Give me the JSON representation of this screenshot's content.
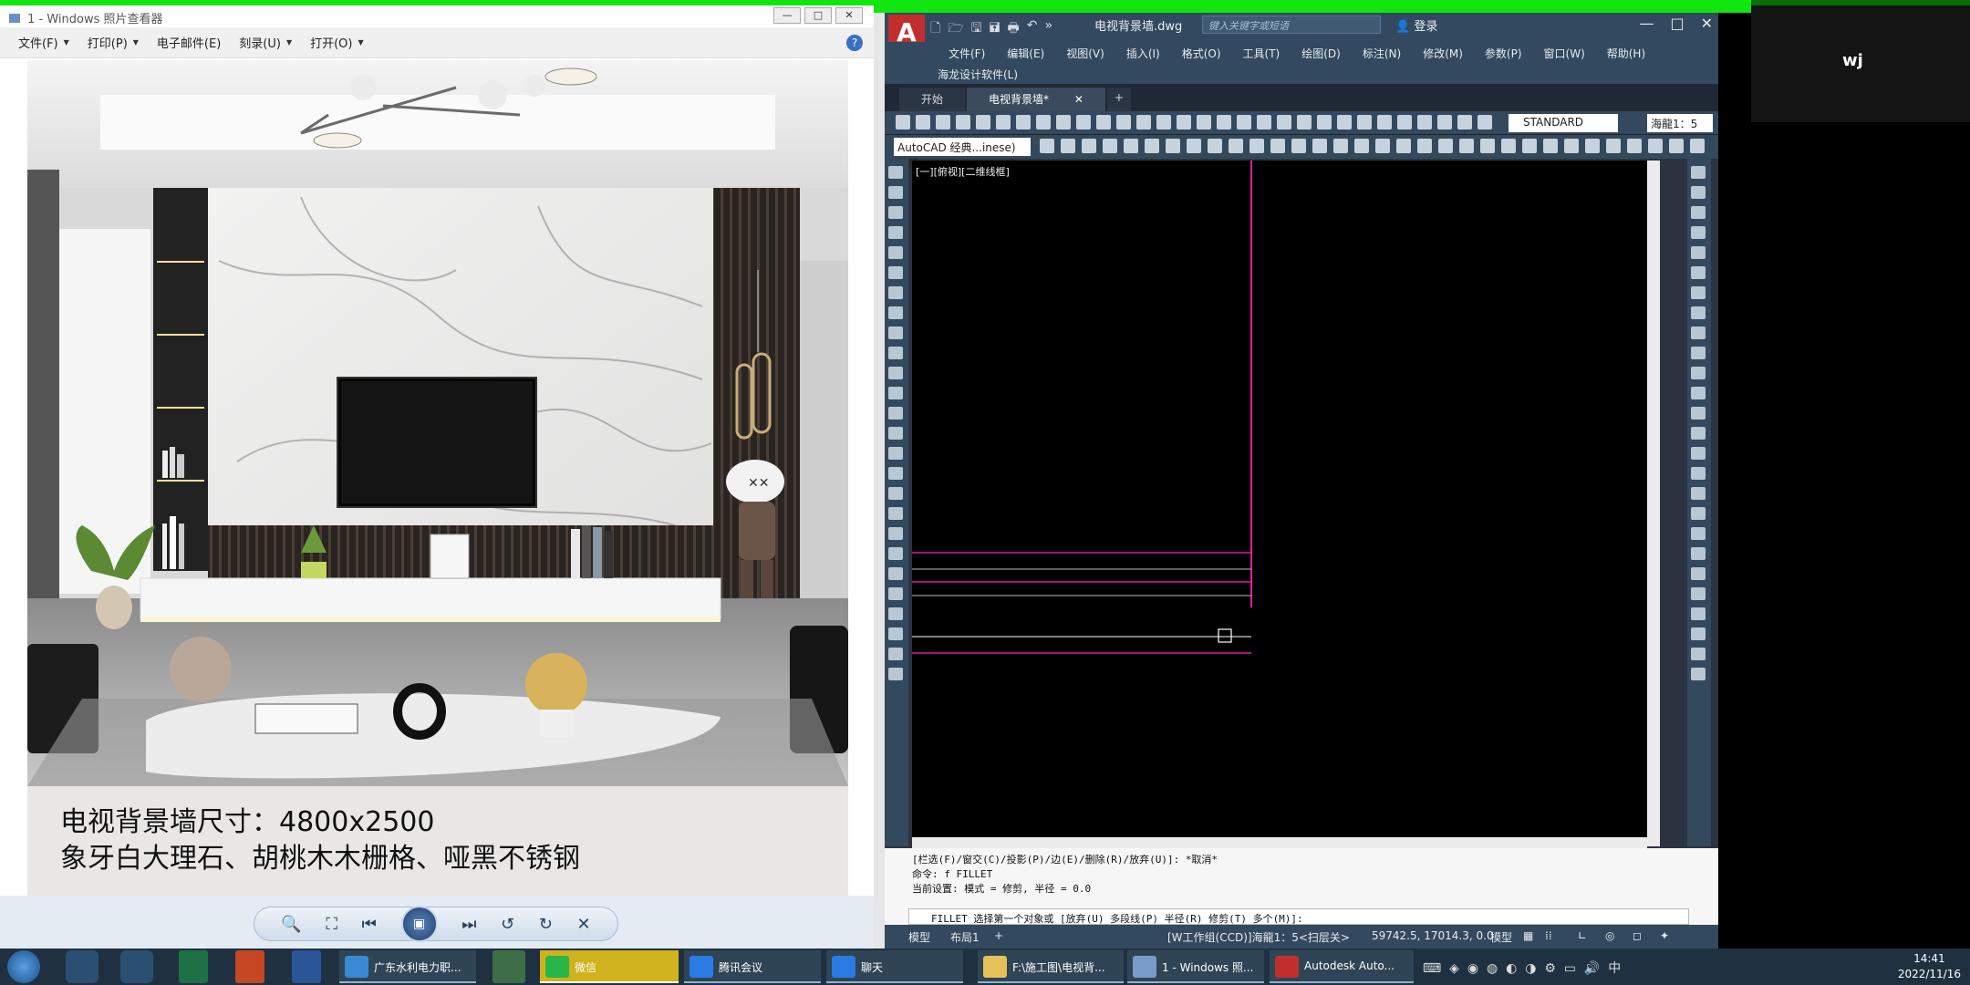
{
  "photo_viewer": {
    "title": "1 - Windows 照片查看器",
    "menu": [
      "文件(F)",
      "打印(P)",
      "电子邮件(E)",
      "刻录(U)",
      "打开(O)"
    ],
    "caption_line1": "电视背景墙尺寸：4800x2500",
    "caption_line2": "象牙白大理石、胡桃木木栅格、哑黑不锈钢"
  },
  "cad": {
    "filename": "电视背景墙.dwg",
    "search_placeholder": "键入关键字或短语",
    "login": "登录",
    "menu": [
      "文件(F)",
      "编辑(E)",
      "视图(V)",
      "插入(I)",
      "格式(O)",
      "工具(T)",
      "绘图(D)",
      "标注(N)",
      "修改(M)",
      "参数(P)",
      "窗口(W)",
      "帮助(H)"
    ],
    "menu_extra": "海龙设计软件(L)",
    "tabs": [
      "开始",
      "电视背景墙*"
    ],
    "workspace": "AutoCAD 经典...inese) 移植",
    "text_style": "STANDARD",
    "scale": "海龍1：5",
    "viewport_label": "[一][俯视][二维线框]",
    "command_lines": [
      "[栏选(F)/窗交(C)/投影(P)/边(E)/删除(R)/放弃(U)]:  *取消*",
      "命令: f FILLET",
      "当前设置: 模式 = 修剪, 半径 = 0.0"
    ],
    "command_prompt": "FILLET 选择第一个对象或 [放弃(U) 多段线(P) 半径(R) 修剪(T) 多个(M)]:",
    "layout_tabs": [
      "模型",
      "布局1"
    ],
    "status_workgroup": "[W工作组(CCD)]海龍1：5<扫层关>",
    "status_coords": "59742.5, 17014.3, 0.0",
    "status_model": "模型"
  },
  "right_panel": {
    "user": "wj"
  },
  "taskbar": {
    "windows": [
      "广东水利电力职...",
      "腾讯会议",
      "聊天",
      "F:\\施工图\\电视背...",
      "1 - Windows 照...",
      "Autodesk Auto..."
    ],
    "active_window": "微信",
    "time": "14:41",
    "date": "2022/11/16"
  },
  "colors": {
    "green_bar": "#11e611",
    "cad_bg": "#000000",
    "magenta_line": "#e01aa0"
  }
}
